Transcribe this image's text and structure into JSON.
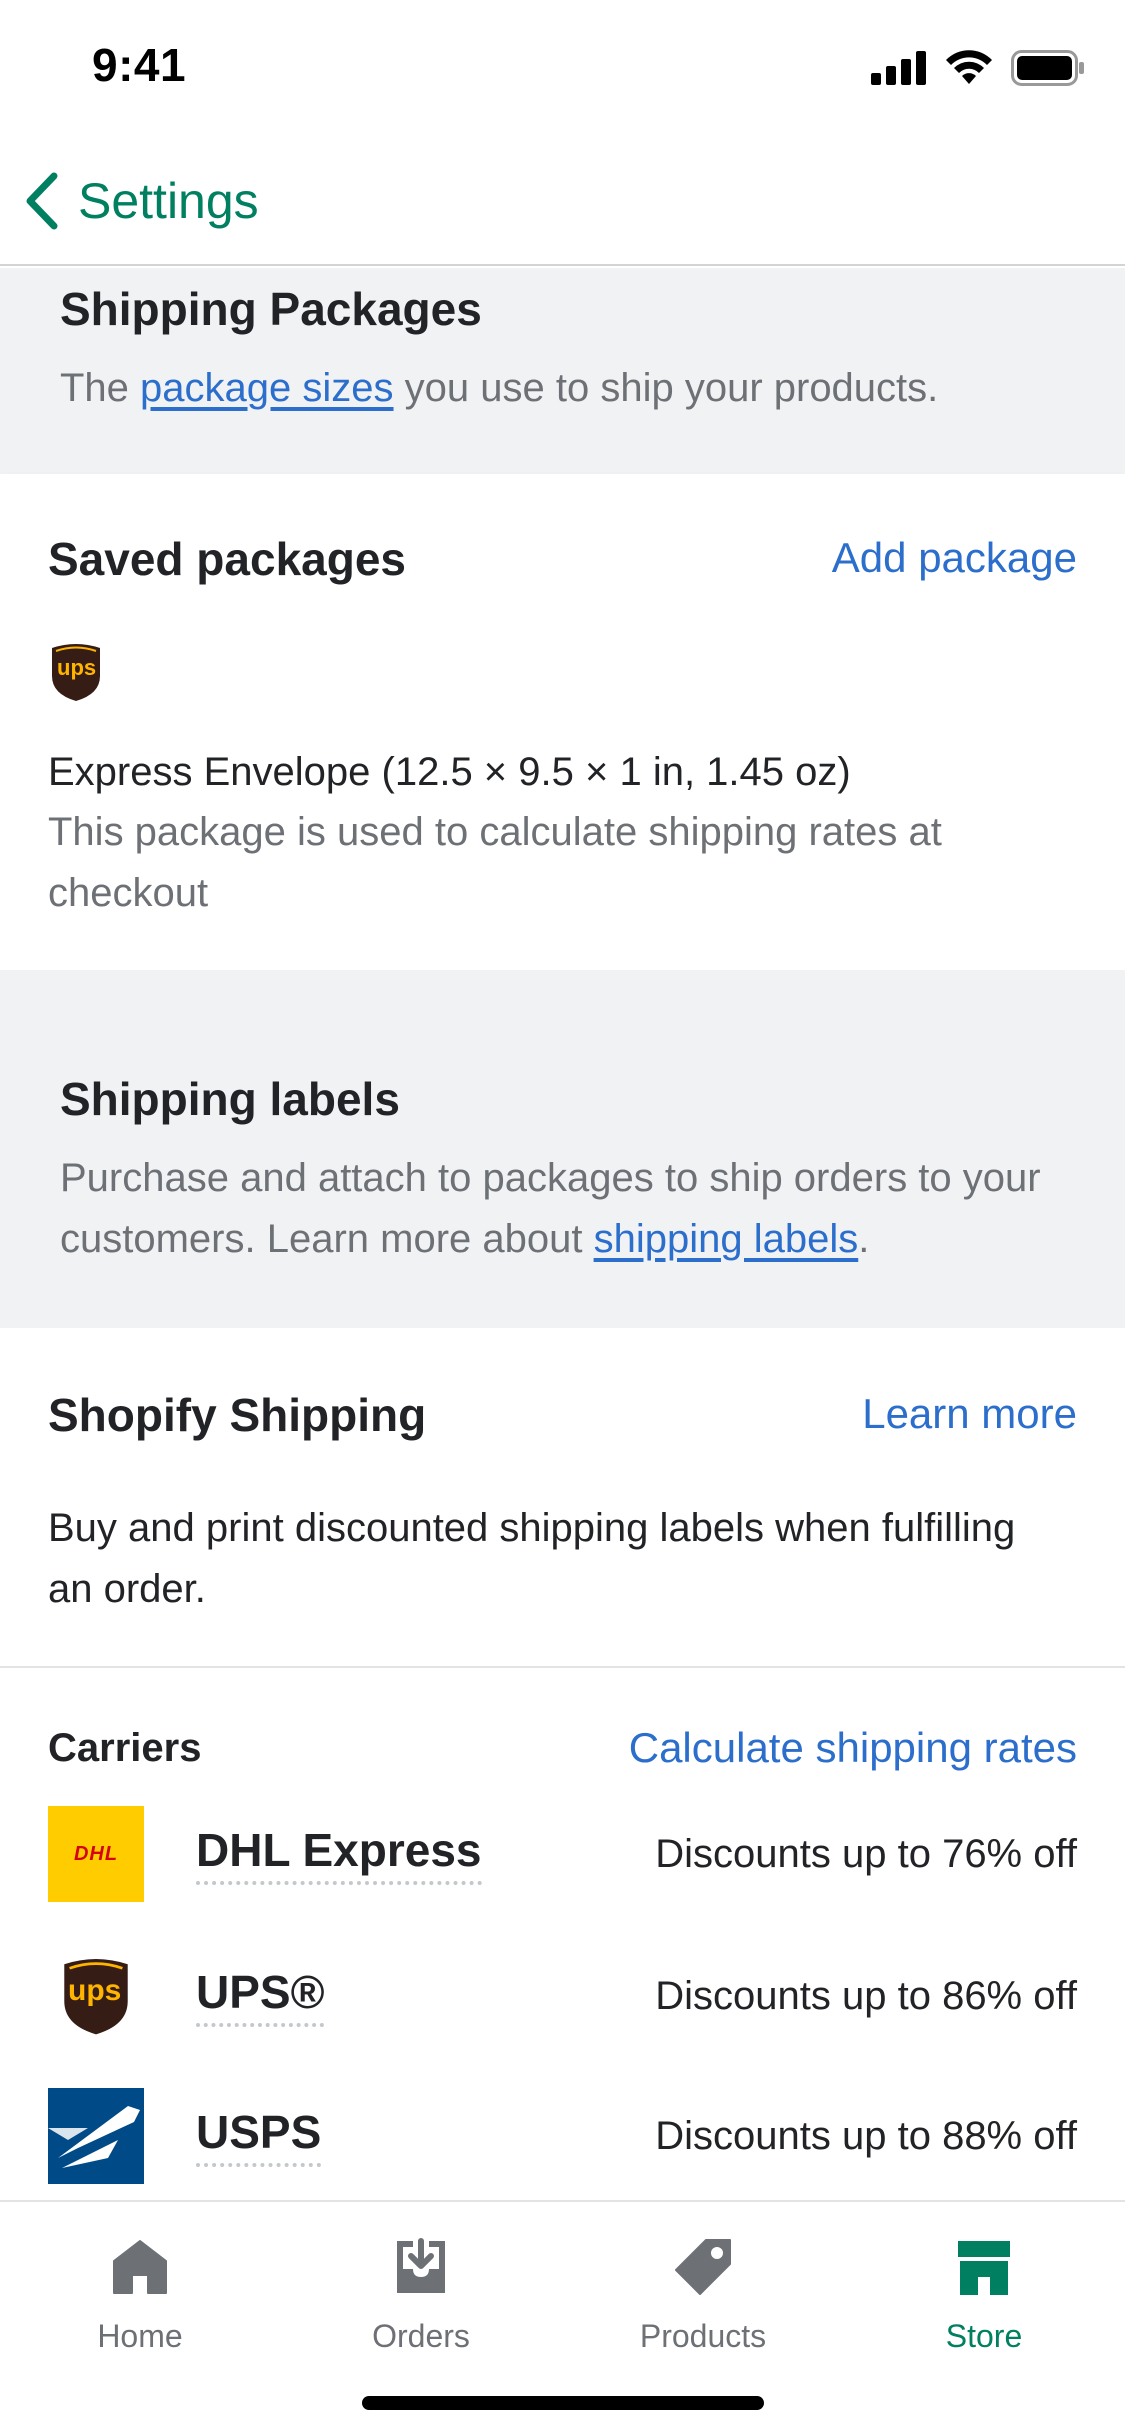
{
  "status_bar": {
    "time": "9:41"
  },
  "nav": {
    "back_label": "Settings"
  },
  "shipping_packages": {
    "title": "Shipping Packages",
    "desc_prefix": "The ",
    "desc_link": "package sizes",
    "desc_suffix": " you use to ship your products."
  },
  "saved_packages": {
    "title": "Saved packages",
    "action": "Add package",
    "package_logo_text": "ups",
    "package_name": "Express Envelope (12.5 × 9.5 × 1 in, 1.45 oz)",
    "package_note": "This package is used to calculate shipping rates at checkout"
  },
  "shipping_labels": {
    "title": "Shipping labels",
    "desc_prefix": "Purchase and attach to packages to ship orders to your customers. Learn more about ",
    "desc_link": "shipping labels",
    "desc_suffix": "."
  },
  "shopify_shipping": {
    "title": "Shopify Shipping",
    "action": "Learn more",
    "desc": "Buy and print discounted shipping labels when fulfilling an order."
  },
  "carriers": {
    "title": "Carriers",
    "action": "Calculate shipping rates",
    "items": [
      {
        "name": "DHL Express",
        "discount": "Discounts up to 76% off",
        "logo_text": "DHL",
        "logo_color": "#FFCC00"
      },
      {
        "name": "UPS®",
        "discount": "Discounts up to 86% off",
        "logo_text": "ups",
        "logo_color": "#351C15"
      },
      {
        "name": "USPS",
        "discount": "Discounts up to 88% off",
        "logo_text": "",
        "logo_color": "#004B87"
      }
    ]
  },
  "tabs": [
    {
      "label": "Home",
      "icon": "home-icon",
      "active": false
    },
    {
      "label": "Orders",
      "icon": "orders-icon",
      "active": false
    },
    {
      "label": "Products",
      "icon": "tag-icon",
      "active": false
    },
    {
      "label": "Store",
      "icon": "store-icon",
      "active": true
    }
  ],
  "colors": {
    "brand_green": "#008060",
    "link_blue": "#2c6ecb",
    "section_gray": "#f1f2f4",
    "muted_text": "#6d7175"
  }
}
